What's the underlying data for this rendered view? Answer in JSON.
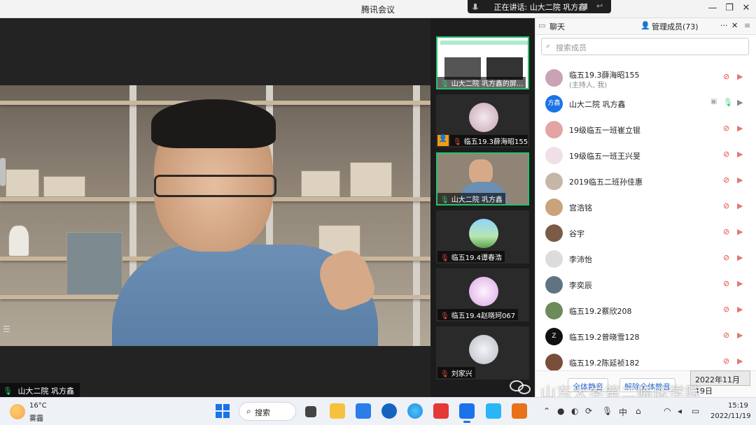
{
  "window": {
    "title": "腾讯会议",
    "speaking": "正在讲话: 山大二院 巩方鑫"
  },
  "main_video": {
    "label": "山大二院 巩方鑫"
  },
  "thumbnails": [
    {
      "label": "山大二院 巩方鑫的屏...",
      "mic": "on",
      "active": true
    },
    {
      "label": "临五19.3薛海昭155",
      "mic": "off",
      "host": true
    },
    {
      "label": "山大二院 巩方鑫",
      "mic": "on",
      "active": true
    },
    {
      "label": "临五19.4谭春浩",
      "mic": "off"
    },
    {
      "label": "临五19.4赵晓珂067",
      "mic": "off"
    },
    {
      "label": "刘家兴",
      "mic": "off"
    }
  ],
  "panel": {
    "tab_chat": "聊天",
    "tab_members": "管理成员(73)",
    "more": "···",
    "close": "✕",
    "search_placeholder": "搜索成员",
    "members": [
      {
        "name": "临五19.3薛海昭155",
        "sub": "(主持人, 我)"
      },
      {
        "name": "山大二院 巩方鑫",
        "avatar_text": "方鑫"
      },
      {
        "name": "19级临五一班崔立锟"
      },
      {
        "name": "19级临五一班王兴旻"
      },
      {
        "name": "2019临五二班孙佳惠"
      },
      {
        "name": "宫浩铭"
      },
      {
        "name": "谷宇"
      },
      {
        "name": "李沛怡"
      },
      {
        "name": "李奕辰"
      },
      {
        "name": "临五19.2蔡欣208"
      },
      {
        "name": "临五19.2曾晓雪128"
      },
      {
        "name": "临五19.2陈延祯182"
      }
    ],
    "mute_all": "全体静音",
    "unmute_all": "解除全体静音"
  },
  "date_tooltip": "2022年11月19日",
  "watermark": "山东大学第二临床学院",
  "taskbar": {
    "temp": "16°C",
    "weather": "雾霾",
    "search": "搜索",
    "ime": "中",
    "time": "15:19",
    "date": "2022/11/19"
  },
  "colors": {
    "accent": "#1a73e8",
    "mic_on": "#2ecc71",
    "mic_off": "#e74c3c",
    "active_border": "#27c26a"
  }
}
